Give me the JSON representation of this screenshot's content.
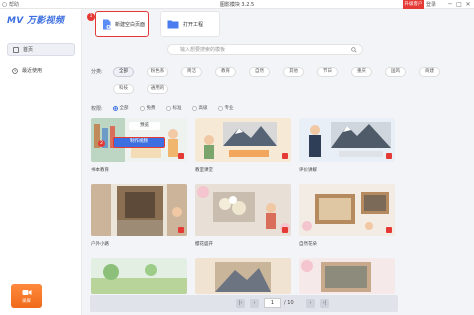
{
  "titlebar": {
    "help": "帮助",
    "title": "图影模块 3.2.5",
    "upgrade": "升级客户",
    "login": "登录",
    "minimize": "─",
    "maximize": "□",
    "close": "✕"
  },
  "sidebar": {
    "logo": "MV 万影视频",
    "items": [
      {
        "label": "首页",
        "icon": "home-icon"
      },
      {
        "label": "最近使用",
        "icon": "clock-icon"
      }
    ],
    "record_label": "录屏"
  },
  "actions": {
    "new_blank": "新建空白页面",
    "open_project": "打开工程",
    "step1": "1",
    "step2": "2"
  },
  "search": {
    "placeholder": "输入想要搜索的模板"
  },
  "filters": {
    "category_label": "分类:",
    "categories": [
      "全部",
      "粉色系",
      "简洁",
      "教育",
      "自然",
      "其他",
      "节日",
      "重庆",
      "国风",
      "商建",
      "科技",
      "通用的"
    ],
    "ratio_label": "权限:",
    "ratios": [
      "全部",
      "免费",
      "标准",
      "高级",
      "专业"
    ]
  },
  "templates": [
    {
      "caption": "书本教育"
    },
    {
      "caption": "教室课堂"
    },
    {
      "caption": "评价讲解"
    },
    {
      "caption": "户外小路"
    },
    {
      "caption": "樱花盛开"
    },
    {
      "caption": "自然花朵"
    },
    {
      "caption": ""
    },
    {
      "caption": ""
    },
    {
      "caption": ""
    }
  ],
  "hover": {
    "preview": "预览",
    "make": "制作视频"
  },
  "pager": {
    "current": "1",
    "total": "/ 10",
    "first": "|‹",
    "prev": "‹",
    "next": "›",
    "last": "›|"
  }
}
